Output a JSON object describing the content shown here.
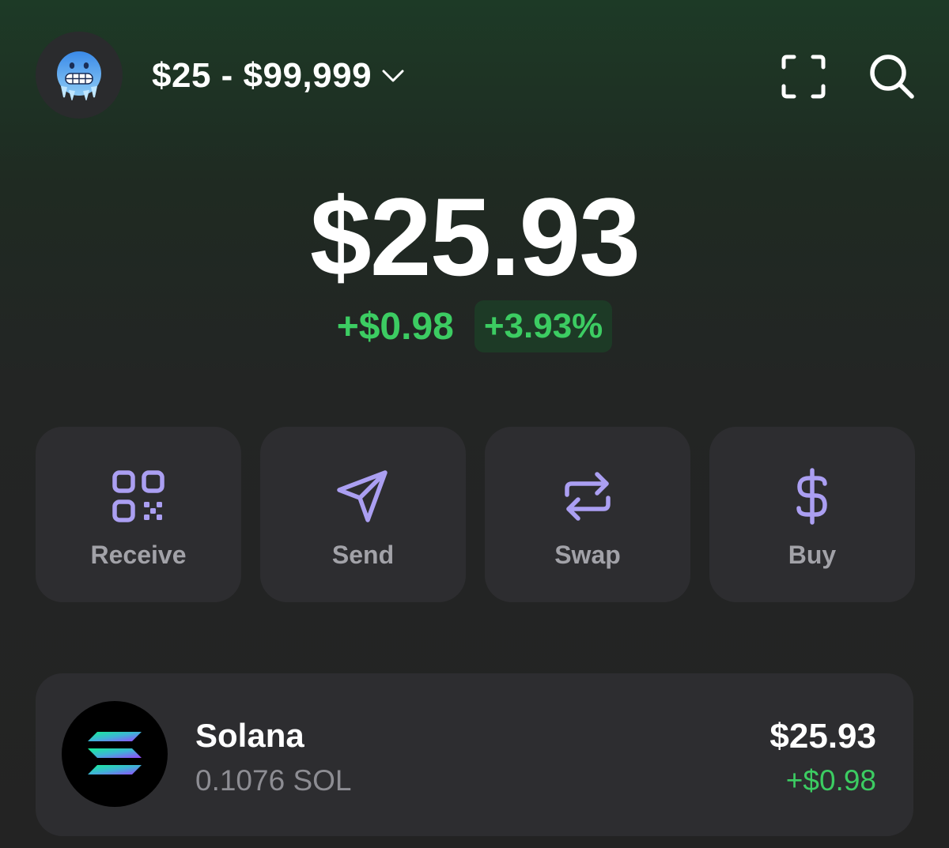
{
  "header": {
    "avatar_icon": "cold-face-emoji-icon",
    "account_range": "$25 - $99,999",
    "dropdown_icon": "chevron-down-icon",
    "scan_icon": "scan-frame-icon",
    "search_icon": "search-icon"
  },
  "balance": {
    "total": "$25.93",
    "change_amount": "+$0.98",
    "change_percent": "+3.93%"
  },
  "actions": [
    {
      "label": "Receive",
      "icon": "qr-code-icon"
    },
    {
      "label": "Send",
      "icon": "paper-plane-icon"
    },
    {
      "label": "Swap",
      "icon": "swap-arrows-icon"
    },
    {
      "label": "Buy",
      "icon": "dollar-icon"
    }
  ],
  "tokens": [
    {
      "name": "Solana",
      "amount": "0.1076 SOL",
      "value": "$25.93",
      "change": "+$0.98",
      "icon": "solana-logo-icon"
    }
  ],
  "colors": {
    "accent_purple": "#ab9ff2",
    "positive_green": "#3ccc62",
    "card_bg": "#2d2d30",
    "header_gradient_top": "#1d3a26"
  }
}
